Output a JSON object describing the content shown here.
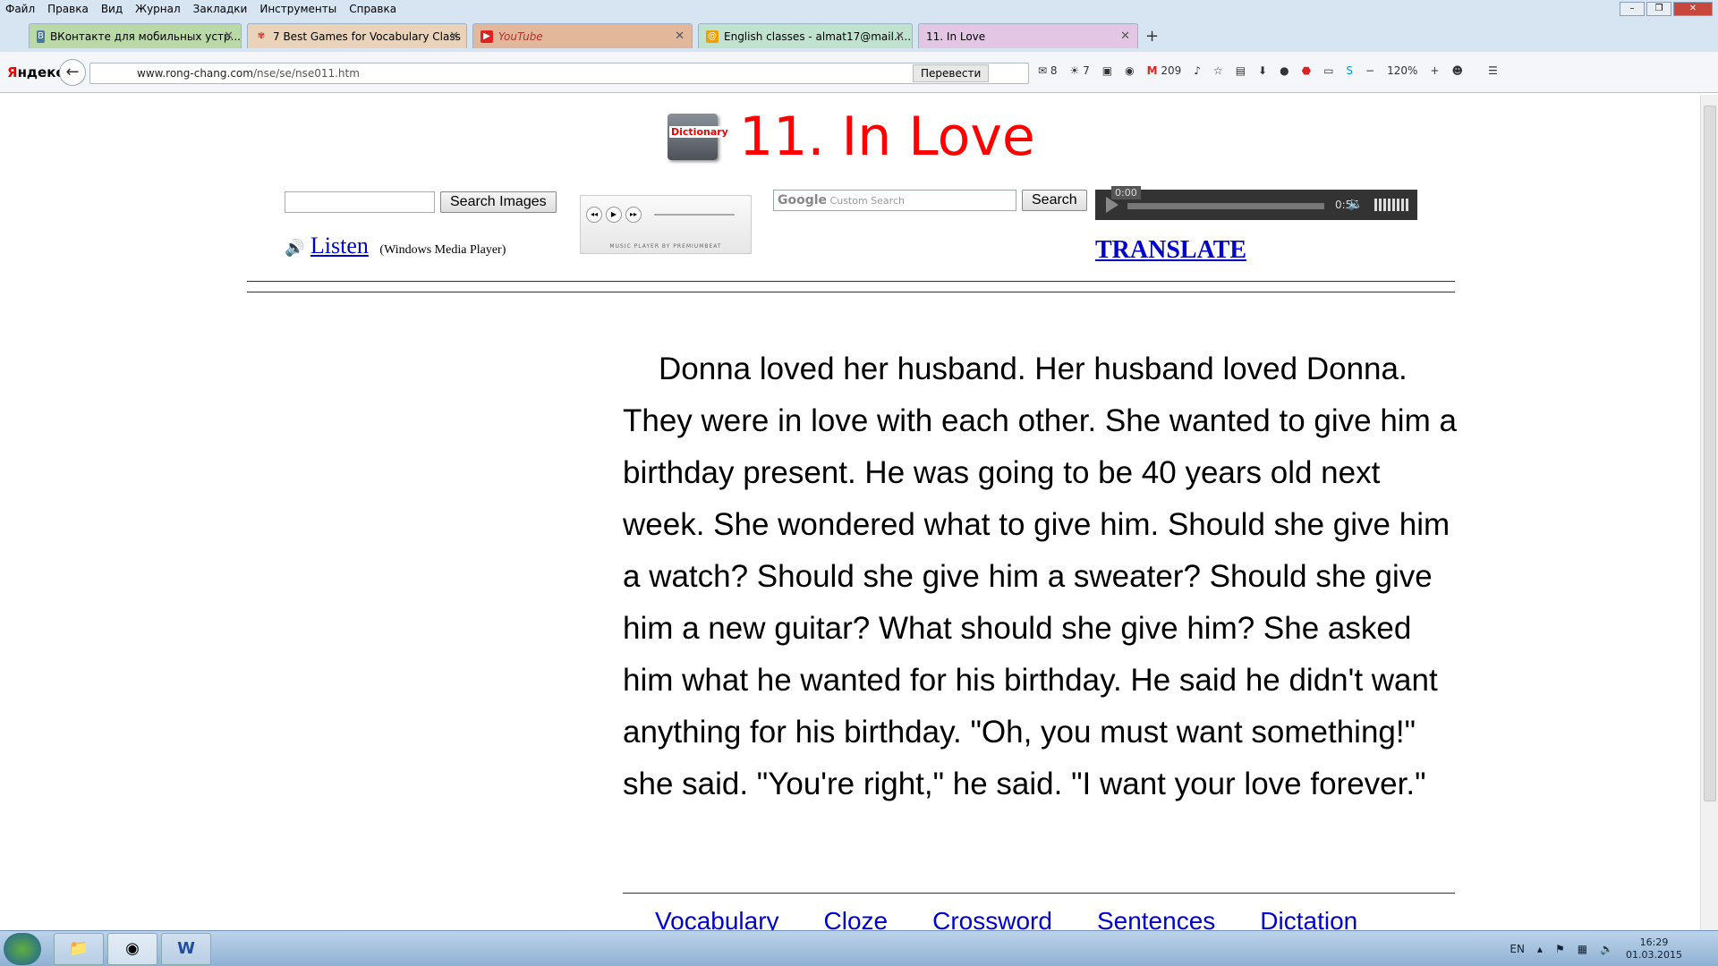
{
  "menu": [
    "Файл",
    "Правка",
    "Вид",
    "Журнал",
    "Закладки",
    "Инструменты",
    "Справка"
  ],
  "tabs": [
    {
      "label": "ВКонтакте для мобильных устр...",
      "fav": "В"
    },
    {
      "label": "7 Best Games for Vocabulary Class",
      "fav": ""
    },
    {
      "label": "YouTube",
      "fav": "▶"
    },
    {
      "label": "English classes - almat17@mail.r...",
      "fav": "@"
    },
    {
      "label": "11. In Love",
      "fav": ""
    }
  ],
  "new_tab": "+",
  "browser": {
    "brand_pre": "Я",
    "brand_post": "ндекс",
    "url_host": "www.rong-chang.com",
    "url_path": "/nse/se/nse011.htm",
    "translate_btn": "Перевести",
    "mail_count": "8",
    "weather": "7",
    "gmail_count": "209",
    "zoom": "120%"
  },
  "page": {
    "dict_icon_text": "Dictionary",
    "title": "11. In Love",
    "search_images_btn": "Search Images",
    "listen_link": "Listen",
    "listen_note": "(Windows Media Player)",
    "music_player_label": "MUSIC PLAYER BY PREMIUMBEAT",
    "google_logo": "Google",
    "google_placeholder": "Custom Search",
    "search_btn": "Search",
    "audio_current": "0:00",
    "audio_duration": "0:56",
    "translate_link": "TRANSLATE",
    "story": "Donna loved her husband. Her husband loved Donna. They were in love with each other. She wanted to give him a birthday present. He was going to be 40 years old next week. She wondered what to give him. Should she give him a watch? Should she give him a sweater? Should she give him a new guitar? What should she give him? She asked him what he wanted for his birthday. He said he didn't want anything for his birthday. \"Oh, you must want something!\" she said. \"You're right,\" he said. \"I want your love forever.\"",
    "bottom_links": [
      "Vocabulary",
      "Cloze",
      "Crossword",
      "Sentences",
      "Dictation"
    ]
  },
  "taskbar": {
    "lang": "EN",
    "time": "16:29",
    "date": "01.03.2015"
  }
}
